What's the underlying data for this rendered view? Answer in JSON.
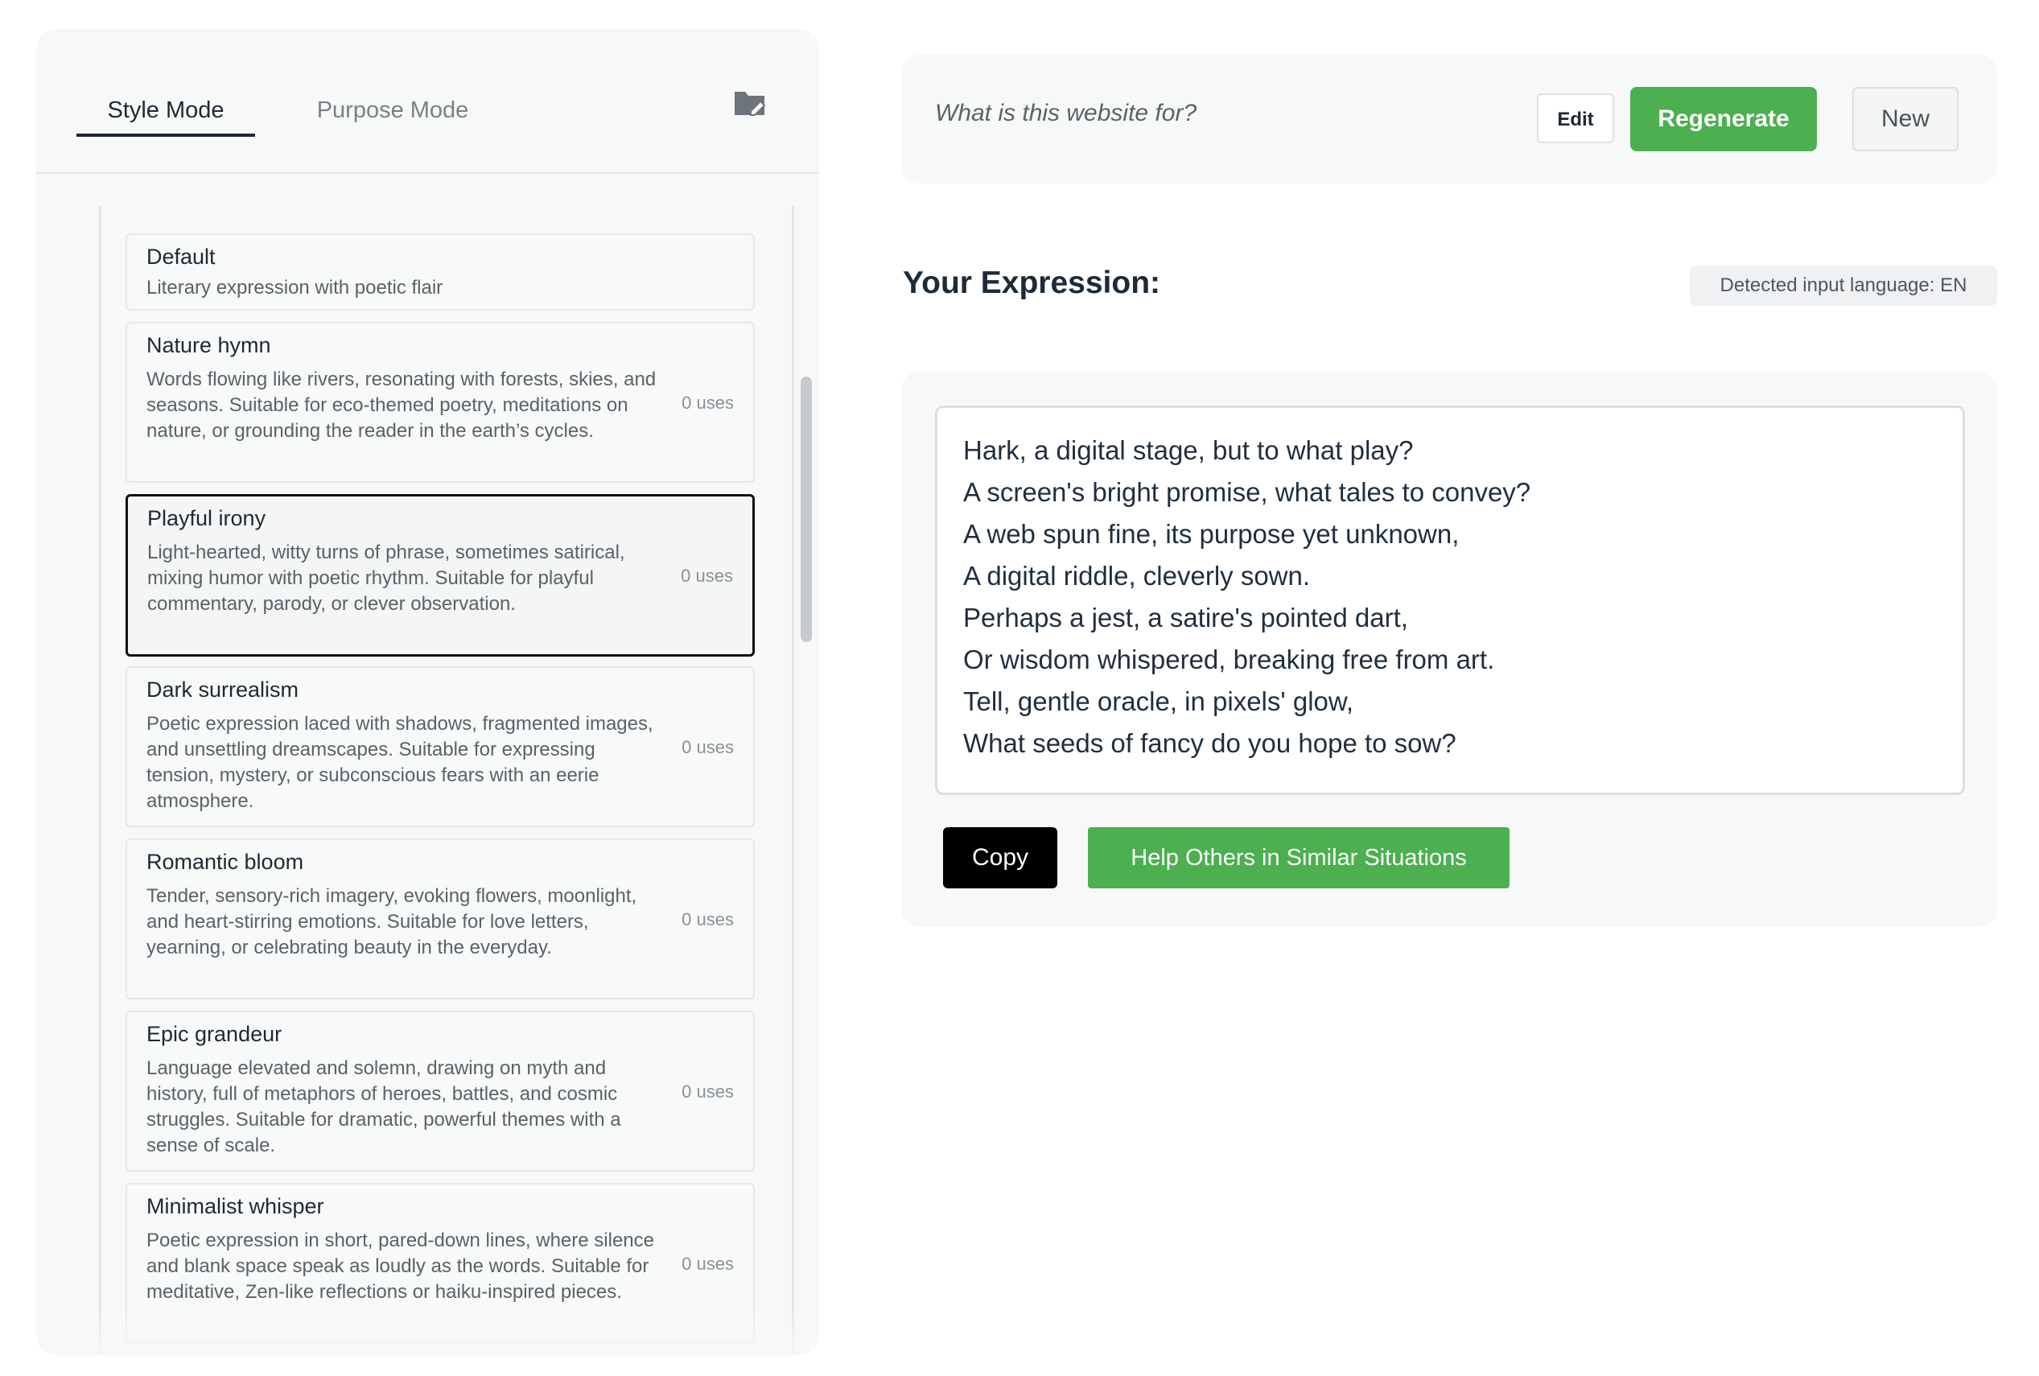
{
  "tabs": {
    "style_mode": "Style Mode",
    "purpose_mode": "Purpose Mode",
    "folder_icon": "folder-edit-icon"
  },
  "styles": [
    {
      "title": "Default",
      "description": "Literary expression with poetic flair",
      "uses": ""
    },
    {
      "title": "Nature hymn",
      "description": "Words flowing like rivers, resonating with forests, skies, and seasons. Suitable for eco-themed poetry, meditations on nature, or grounding the reader in the earth’s cycles.",
      "uses": "0 uses"
    },
    {
      "title": "Playful irony",
      "description": "Light-hearted, witty turns of phrase, sometimes satirical, mixing humor with poetic rhythm. Suitable for playful commentary, parody, or clever observation.",
      "uses": "0 uses",
      "selected": true
    },
    {
      "title": "Dark surrealism",
      "description": "Poetic expression laced with shadows, fragmented images, and unsettling dreamscapes. Suitable for expressing tension, mystery, or subconscious fears with an eerie atmosphere.",
      "uses": "0 uses"
    },
    {
      "title": "Romantic bloom",
      "description": "Tender, sensory-rich imagery, evoking flowers, moonlight, and heart-stirring emotions. Suitable for love letters, yearning, or celebrating beauty in the everyday.",
      "uses": "0 uses"
    },
    {
      "title": "Epic grandeur",
      "description": "Language elevated and solemn, drawing on myth and history, full of metaphors of heroes, battles, and cosmic struggles. Suitable for dramatic, powerful themes with a sense of scale.",
      "uses": "0 uses"
    },
    {
      "title": "Minimalist whisper",
      "description": "Poetic expression in short, pared-down lines, where silence and blank space speak as loudly as the words. Suitable for meditative, Zen-like reflections or haiku-inspired pieces.",
      "uses": "0 uses"
    }
  ],
  "query": {
    "text": "What is this website for?",
    "edit_label": "Edit",
    "regenerate_label": "Regenerate",
    "new_label": "New"
  },
  "result": {
    "heading": "Your Expression:",
    "language_badge": "Detected input language: EN",
    "lines": [
      "Hark, a digital stage, but to what play?",
      "A screen's bright promise, what tales to convey?",
      "A web spun fine, its purpose yet unknown,",
      "A digital riddle, cleverly sown.",
      "Perhaps a jest, a satire's pointed dart,",
      "Or wisdom whispered, breaking free from art.",
      "Tell, gentle oracle, in pixels' glow,",
      "What seeds of fancy do you hope to sow?"
    ],
    "copy_label": "Copy",
    "help_label": "Help Others in Similar Situations"
  },
  "colors": {
    "accent_green": "#4caf50",
    "panel_bg": "#f7f8f8",
    "heading": "#1c2b3a"
  }
}
